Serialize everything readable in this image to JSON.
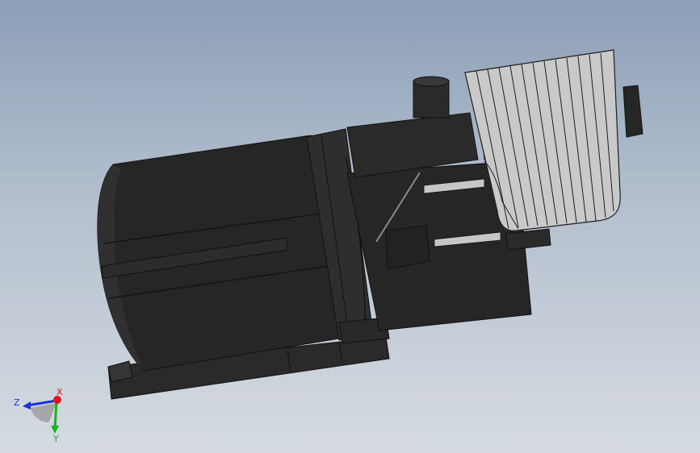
{
  "viewport": {
    "background_top": "#8c9fb8",
    "background_bottom": "#d5dbe1"
  },
  "model": {
    "body_color": "#262626",
    "fin_color": "#c9c9c9",
    "fin_edge_color": "#1e1e1e"
  },
  "triad": {
    "x_label": "X",
    "y_label": "Y",
    "z_label": "Z",
    "x_color": "#e0141e",
    "y_color": "#19b419",
    "z_color": "#1a32dc"
  }
}
